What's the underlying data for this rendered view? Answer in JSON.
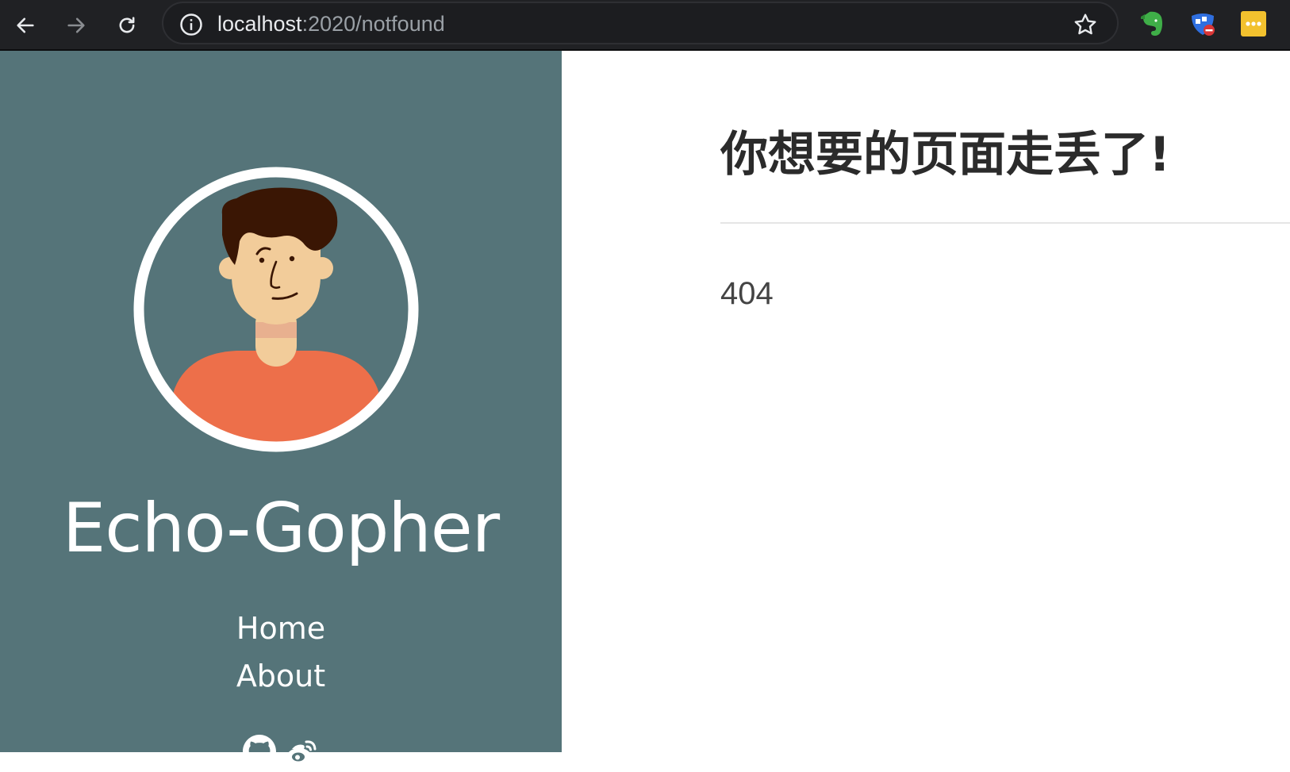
{
  "browser": {
    "url_host": "localhost",
    "url_rest": ":2020/notfound",
    "icons": {
      "back": "back-arrow-icon",
      "forward": "forward-arrow-icon",
      "reload": "reload-icon",
      "info": "info-icon",
      "bookmark": "star-icon",
      "extensions": [
        "evernote-icon",
        "adblock-icon",
        "dots-extension-icon"
      ]
    }
  },
  "sidebar": {
    "background_color": "#557479",
    "title": "Echo-Gopher",
    "nav": [
      {
        "label": "Home"
      },
      {
        "label": "About"
      }
    ],
    "social_icons": [
      "github-icon",
      "weibo-icon"
    ]
  },
  "main": {
    "heading": "你想要的页面走丢了!",
    "body": "404"
  }
}
